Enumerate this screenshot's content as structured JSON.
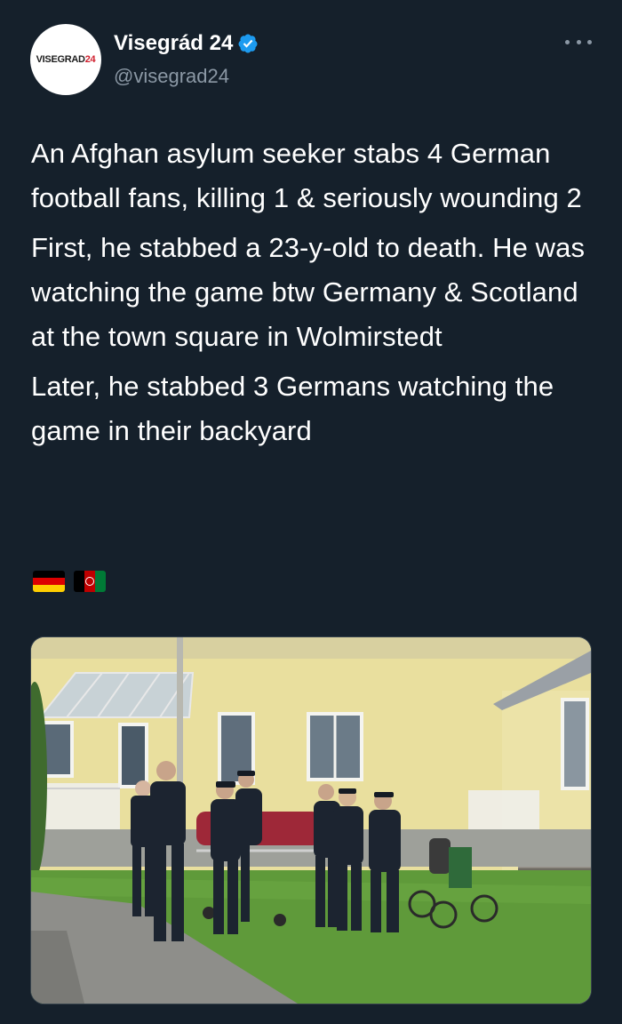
{
  "author": {
    "avatar_logo_main": "VISEGRAD",
    "avatar_logo_accent": "24",
    "display_name": "Visegrád 24",
    "handle": "@visegrad24",
    "verified": true
  },
  "tweet": {
    "paragraphs": [
      "An Afghan asylum seeker stabs 4 German football fans, killing 1 & seriously wounding 2",
      "First, he stabbed a 23-y-old to death. He was watching the game btw Germany & Scotland at the town square in Wolmirstedt",
      "Later, he stabbed 3 Germans watching the game in their backyard"
    ],
    "flags": [
      "germany-flag",
      "afghanistan-flag"
    ]
  },
  "icons": {
    "verified": "verified-badge-icon",
    "more": "more-options-icon"
  },
  "colors": {
    "background": "#15202b",
    "text": "#ffffff",
    "secondary": "#8b98a5",
    "verified": "#1d9bf0",
    "brand_accent": "#d0202e"
  }
}
